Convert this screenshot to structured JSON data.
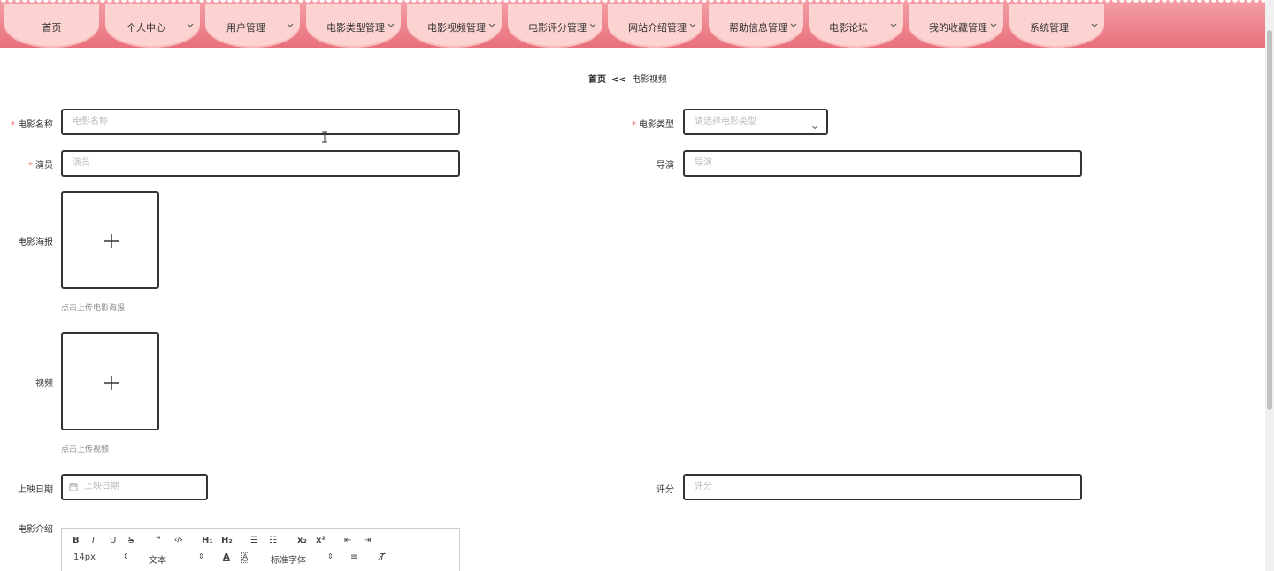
{
  "nav": {
    "items": [
      {
        "label": "首页"
      },
      {
        "label": "个人中心"
      },
      {
        "label": "用户管理"
      },
      {
        "label": "电影类型管理"
      },
      {
        "label": "电影视频管理"
      },
      {
        "label": "电影评分管理"
      },
      {
        "label": "网站介绍管理"
      },
      {
        "label": "帮助信息管理"
      },
      {
        "label": "电影论坛"
      },
      {
        "label": "我的收藏管理"
      },
      {
        "label": "系统管理"
      }
    ]
  },
  "breadcrumb": {
    "home": "首页",
    "separator": "<<",
    "current": "电影视频"
  },
  "form": {
    "required_mark": "*",
    "name": {
      "label": "电影名称",
      "placeholder": "电影名称"
    },
    "type": {
      "label": "电影类型",
      "placeholder": "请选择电影类型"
    },
    "actors": {
      "label": "演员",
      "placeholder": "演员"
    },
    "director": {
      "label": "导演",
      "placeholder": "导演"
    },
    "poster": {
      "label": "电影海报",
      "tip": "点击上传电影海报"
    },
    "video": {
      "label": "视频",
      "tip": "点击上传视频"
    },
    "release_date": {
      "label": "上映日期",
      "placeholder": "上映日期"
    },
    "score": {
      "label": "评分",
      "placeholder": "评分"
    },
    "intro": {
      "label": "电影介绍"
    }
  },
  "editor": {
    "toolbar": {
      "bold": "B",
      "italic": "I",
      "underline": "U",
      "strike": "S",
      "quote": "❞",
      "code": "‹/›",
      "h1": "H₁",
      "h2": "H₂",
      "ordered_list": "☰",
      "bullet_list": "☷",
      "sub": "x₂",
      "sup": "x²",
      "outdent": "⇤",
      "indent": "⇥",
      "size": "14px",
      "format": "文本",
      "font_color": "A",
      "bg_color": "A̲",
      "font": "标准字体",
      "align": "≡",
      "clean": "T̸"
    }
  }
}
